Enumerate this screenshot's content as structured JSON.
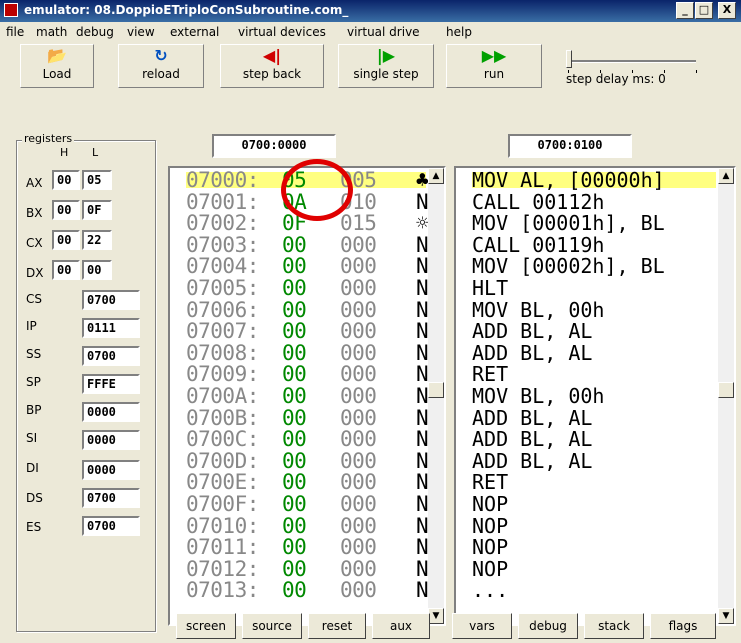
{
  "title": "emulator: 08.DoppioETriploConSubroutine.com_",
  "titlebar_buttons": {
    "minimize": "_",
    "maximize": "□",
    "close": "X"
  },
  "menu": [
    "file",
    "math",
    "debug",
    "view",
    "external",
    "virtual devices",
    "virtual drive",
    "help"
  ],
  "toolbar": {
    "load": "Load",
    "reload": "reload",
    "step_back": "step back",
    "single_step": "single step",
    "run": "run",
    "step_delay": "step delay ms: 0"
  },
  "icons": {
    "load": "folder-open-icon",
    "reload": "reload-icon",
    "step_back": "step-back-icon",
    "single_step": "single-step-icon",
    "run": "run-icon"
  },
  "registers": {
    "group_title": "registers",
    "h_label": "H",
    "l_label": "L",
    "split": [
      {
        "name": "AX",
        "h": "00",
        "l": "05"
      },
      {
        "name": "BX",
        "h": "00",
        "l": "0F"
      },
      {
        "name": "CX",
        "h": "00",
        "l": "22"
      },
      {
        "name": "DX",
        "h": "00",
        "l": "00"
      }
    ],
    "full": [
      {
        "name": "CS",
        "value": "0700"
      },
      {
        "name": "IP",
        "value": "0111"
      },
      {
        "name": "SS",
        "value": "0700"
      },
      {
        "name": "SP",
        "value": "FFFE"
      },
      {
        "name": "BP",
        "value": "0000"
      },
      {
        "name": "SI",
        "value": "0000"
      },
      {
        "name": "DI",
        "value": "0000"
      },
      {
        "name": "DS",
        "value": "0700"
      },
      {
        "name": "ES",
        "value": "0700"
      }
    ]
  },
  "memory": {
    "address": "0700:0000",
    "rows": [
      {
        "addr": "07000:",
        "hex": "05",
        "dec": "005",
        "chr": "♣"
      },
      {
        "addr": "07001:",
        "hex": "0A",
        "dec": "010",
        "chr": "NL"
      },
      {
        "addr": "07002:",
        "hex": "0F",
        "dec": "015",
        "chr": "☼"
      },
      {
        "addr": "07003:",
        "hex": "00",
        "dec": "000",
        "chr": "NU"
      },
      {
        "addr": "07004:",
        "hex": "00",
        "dec": "000",
        "chr": "NU"
      },
      {
        "addr": "07005:",
        "hex": "00",
        "dec": "000",
        "chr": "NU"
      },
      {
        "addr": "07006:",
        "hex": "00",
        "dec": "000",
        "chr": "NU"
      },
      {
        "addr": "07007:",
        "hex": "00",
        "dec": "000",
        "chr": "NU"
      },
      {
        "addr": "07008:",
        "hex": "00",
        "dec": "000",
        "chr": "NU"
      },
      {
        "addr": "07009:",
        "hex": "00",
        "dec": "000",
        "chr": "NU"
      },
      {
        "addr": "0700A:",
        "hex": "00",
        "dec": "000",
        "chr": "NU"
      },
      {
        "addr": "0700B:",
        "hex": "00",
        "dec": "000",
        "chr": "NU"
      },
      {
        "addr": "0700C:",
        "hex": "00",
        "dec": "000",
        "chr": "NU"
      },
      {
        "addr": "0700D:",
        "hex": "00",
        "dec": "000",
        "chr": "NU"
      },
      {
        "addr": "0700E:",
        "hex": "00",
        "dec": "000",
        "chr": "NU"
      },
      {
        "addr": "0700F:",
        "hex": "00",
        "dec": "000",
        "chr": "NU"
      },
      {
        "addr": "07010:",
        "hex": "00",
        "dec": "000",
        "chr": "NU"
      },
      {
        "addr": "07011:",
        "hex": "00",
        "dec": "000",
        "chr": "NU"
      },
      {
        "addr": "07012:",
        "hex": "00",
        "dec": "000",
        "chr": "NU"
      },
      {
        "addr": "07013:",
        "hex": "00",
        "dec": "000",
        "chr": "NU"
      }
    ]
  },
  "disassembly": {
    "address": "0700:0100",
    "rows": [
      "MOV AL, [00000h]",
      "CALL 00112h",
      "MOV [00001h], BL",
      "CALL 00119h",
      "MOV [00002h], BL",
      "HLT",
      "MOV BL, 00h",
      "ADD BL, AL",
      "ADD BL, AL",
      "RET",
      "MOV BL, 00h",
      "ADD BL, AL",
      "ADD BL, AL",
      "ADD BL, AL",
      "RET",
      "NOP",
      "NOP",
      "NOP",
      "NOP",
      "..."
    ]
  },
  "bottom_buttons": [
    "screen",
    "source",
    "reset",
    "aux",
    "vars",
    "debug",
    "stack",
    "flags"
  ]
}
